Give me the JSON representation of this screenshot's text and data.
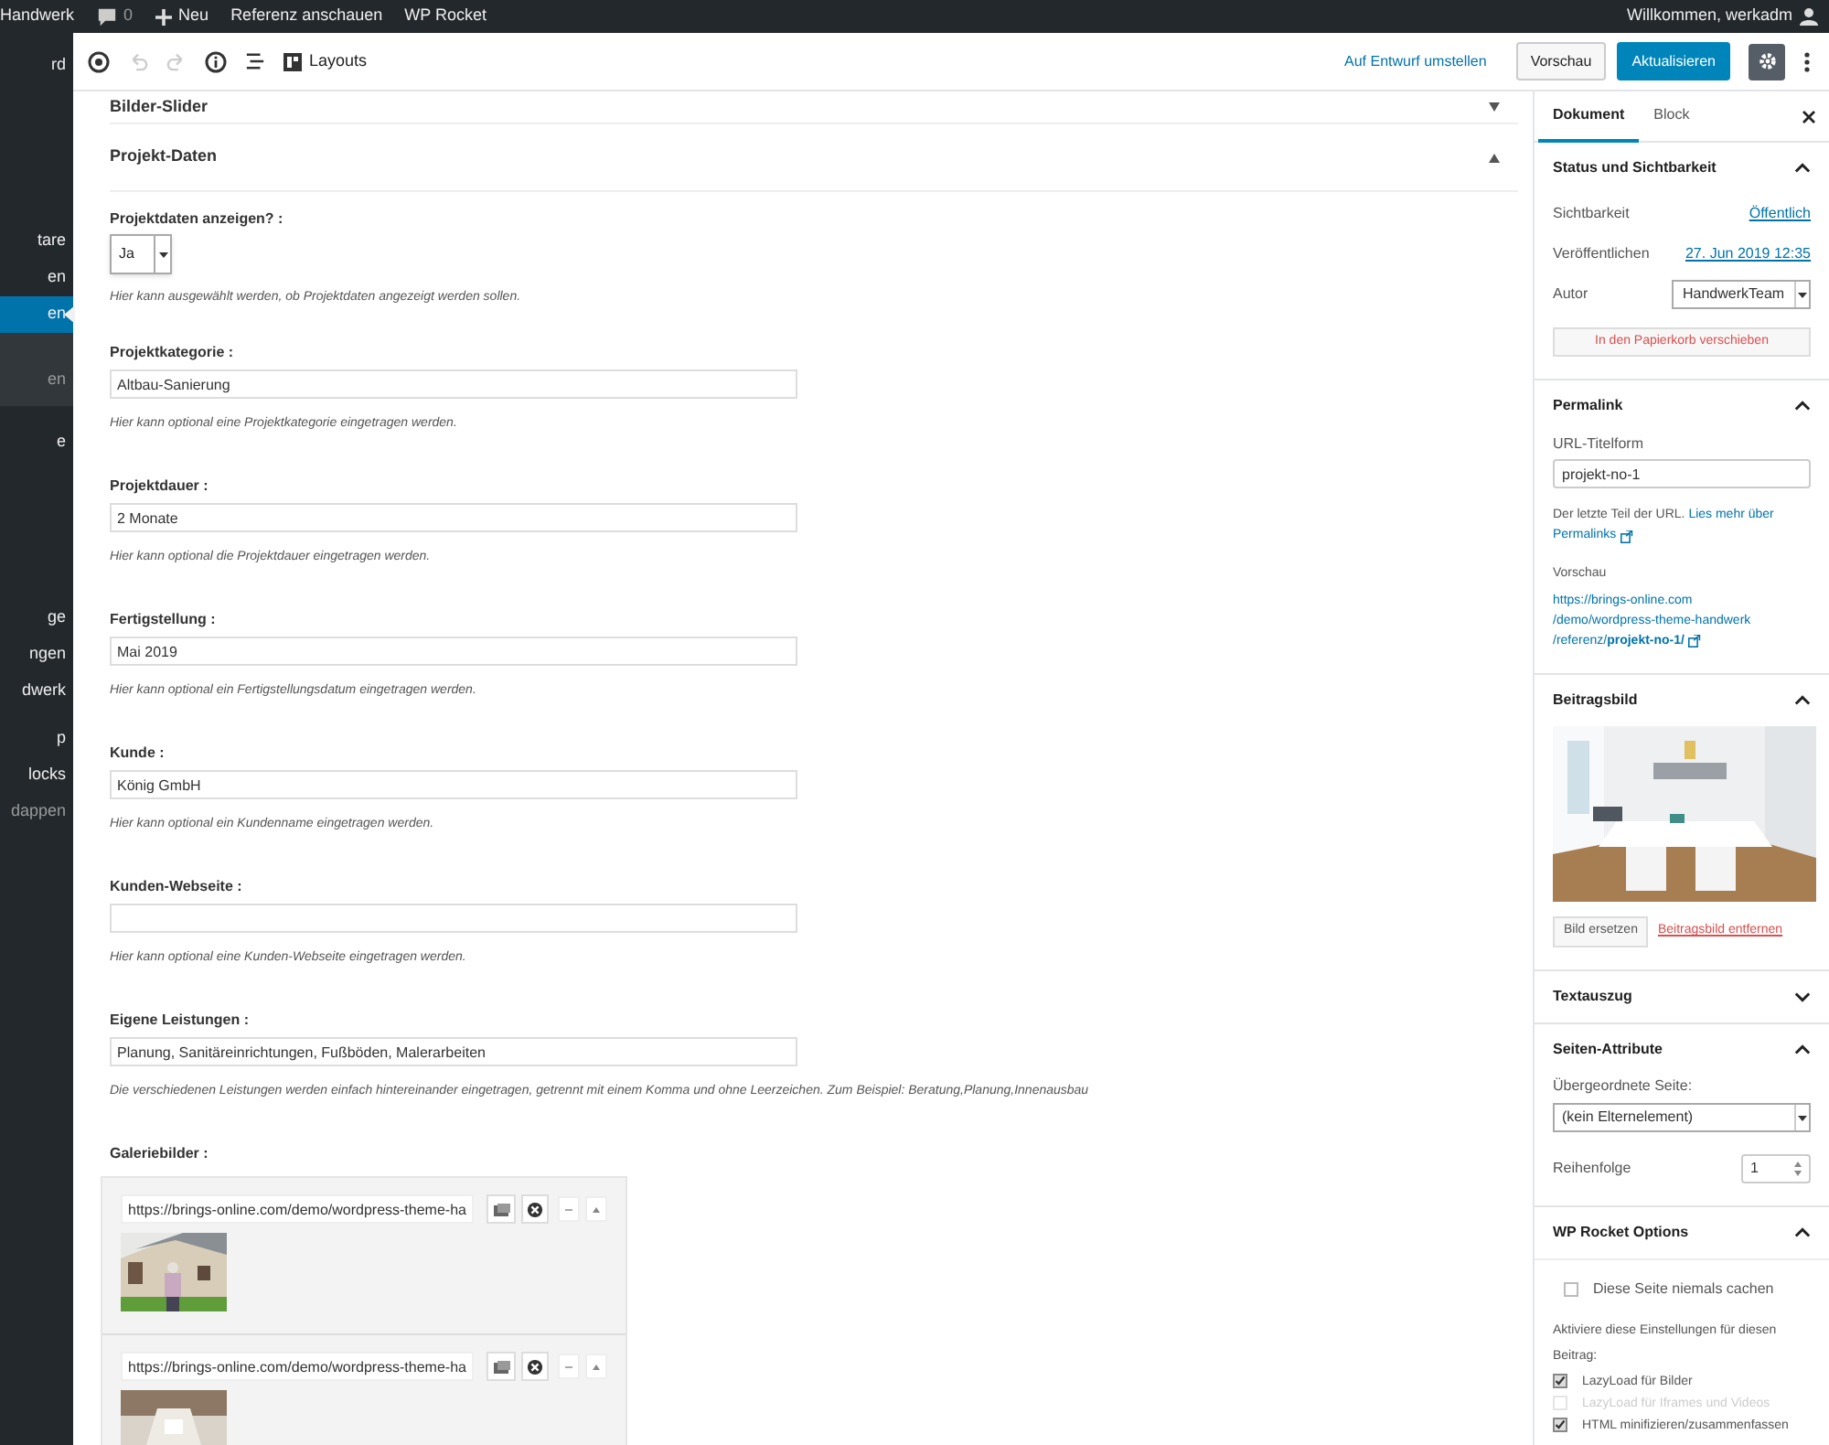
{
  "admin_bar": {
    "site": "Handwerk",
    "comments": "0",
    "new": "Neu",
    "links": [
      "Referenz anschauen",
      "WP Rocket"
    ],
    "greeting": "Willkommen, werkadm"
  },
  "admin_menu": [
    {
      "label": "rd",
      "selected": false
    },
    {
      "label": "tare",
      "selected": false
    },
    {
      "label": "en",
      "selected": false
    },
    {
      "label": "en",
      "selected": true,
      "children": [
        {
          "label": "en",
          "selected": false
        }
      ]
    },
    {
      "label": "e",
      "selected": false
    },
    {
      "label": "ge",
      "selected": false
    },
    {
      "label": "ngen",
      "selected": false
    },
    {
      "label": "dwerk",
      "selected": false
    },
    {
      "label": "p",
      "selected": false
    },
    {
      "label": "locks",
      "selected": false
    },
    {
      "label": "dappen",
      "selected": false,
      "kind": "collapse"
    }
  ],
  "toolbar": {
    "undo_disabled": true,
    "layouts": "Layouts",
    "draft_link": "Auf Entwurf umstellen",
    "preview": "Vorschau",
    "update": "Aktualisieren",
    "settings_pressed": true
  },
  "sections": [
    {
      "title": "Bilder-Slider",
      "expanded": false
    },
    {
      "title": "Projekt-Daten",
      "expanded": true
    }
  ],
  "fields": [
    {
      "kind": "select",
      "label": "Projektdaten anzeigen? :",
      "value": "Ja",
      "help": "Hier kann ausgewählt werden, ob Projektdaten angezeigt werden sollen."
    },
    {
      "kind": "text",
      "label": "Projektkategorie :",
      "value": "Altbau-Sanierung",
      "help": "Hier kann optional eine Projektkategorie eingetragen werden."
    },
    {
      "kind": "text",
      "label": "Projektdauer :",
      "value": "2 Monate",
      "help": "Hier kann optional die Projektdauer eingetragen werden."
    },
    {
      "kind": "text",
      "label": "Fertigstellung :",
      "value": "Mai 2019",
      "help": "Hier kann optional ein Fertigstellungsdatum eingetragen werden."
    },
    {
      "kind": "text",
      "label": "Kunde :",
      "value": "König GmbH",
      "help": "Hier kann optional ein Kundenname eingetragen werden."
    },
    {
      "kind": "text",
      "label": "Kunden-Webseite :",
      "help": "Hier kann optional eine Kunden-Webseite eingetragen werden."
    },
    {
      "kind": "text",
      "label": "Eigene Leistungen :",
      "value": "Planung, Sanitäreinrichtungen, Fußböden, Malerarbeiten",
      "help": "Die verschiedenen Leistungen werden einfach hintereinander eingetragen, getrennt mit einem Komma und ohne Leerzeichen. Zum Beispiel: Beratung,Planung,Innenausbau"
    }
  ],
  "gallery": {
    "label": "Galeriebilder :",
    "items": [
      {
        "url": "https://brings-online.com/demo/wordpress-theme-ha",
        "kind": "picture"
      },
      {
        "url": "https://brings-online.com/demo/wordpress-theme-ha",
        "kind": "picture"
      }
    ]
  },
  "sidebar": {
    "tabs": [
      {
        "label": "Dokument",
        "selected": true
      },
      {
        "label": "Block",
        "selected": false
      }
    ],
    "status": {
      "title": "Status und Sichtbarkeit",
      "expanded": true,
      "rows": [
        {
          "label": "Sichtbarkeit",
          "value": "Öffentlich"
        },
        {
          "label": "Veröffentlichen",
          "value": "27. Jun 2019 12:35"
        }
      ],
      "author_label": "Autor",
      "author": "HandwerkTeam",
      "trash": "In den Papierkorb verschieben"
    },
    "permalink": {
      "title": "Permalink",
      "expanded": true,
      "label": "URL-Titelform",
      "value": "projekt-no-1",
      "note": "Der letzte Teil der URL.",
      "more": "Lies mehr über",
      "more2": "Permalinks",
      "preview_label": "Vorschau",
      "url_lines": [
        "https://brings-online.com",
        "/demo/wordpress-theme-handwerk"
      ],
      "url_last": "/referenz/",
      "url_slug": "projekt-no-1/"
    },
    "featured": {
      "title": "Beitragsbild",
      "expanded": true,
      "replace": "Bild ersetzen",
      "remove": "Beitragsbild entfernen"
    },
    "excerpt": {
      "title": "Textauszug",
      "expanded": false
    },
    "attributes": {
      "title": "Seiten-Attribute",
      "expanded": true,
      "parent_label": "Übergeordnete Seite:",
      "parent": "(kein Elternelement)",
      "order_label": "Reihenfolge",
      "order": "1"
    },
    "rocket": {
      "title": "WP Rocket Options",
      "expanded": true,
      "never_cache": {
        "label": "Diese Seite niemals cachen",
        "checked": false
      },
      "intro": "Aktiviere diese Einstellungen für diesen Beitrag:",
      "options": [
        {
          "label": "LazyLoad für Bilder",
          "checked": true,
          "disabled": false
        },
        {
          "label": "LazyLoad für Iframes und Videos",
          "checked": false,
          "disabled": true
        },
        {
          "label": "HTML minifizieren/zusammenfassen",
          "checked": true,
          "disabled": false
        }
      ]
    }
  }
}
